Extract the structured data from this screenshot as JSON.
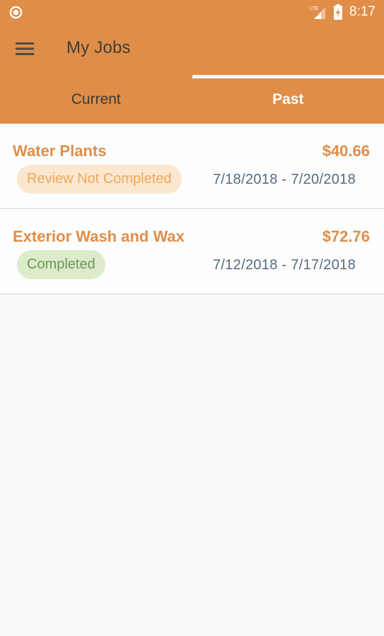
{
  "status_bar": {
    "left_icon": "circle-notification-icon",
    "network_label": "LTE",
    "time": "8:17"
  },
  "app_bar": {
    "menu_icon": "hamburger-menu-icon",
    "title": "My Jobs"
  },
  "tabs": [
    {
      "label": "Current",
      "selected": false
    },
    {
      "label": "Past",
      "selected": true
    }
  ],
  "jobs": [
    {
      "title": "Water Plants",
      "price": "$40.66",
      "status": "Review Not Completed",
      "dates": "7/18/2018 - 7/20/2018"
    },
    {
      "title": "Exterior Wash and Wax",
      "price": "$72.76",
      "status": "Completed",
      "dates": "7/12/2018 - 7/17/2018"
    }
  ],
  "colors": {
    "primary": "#e08d47",
    "badge_review_bg": "#fbe6cf",
    "badge_review_text": "#f0a85c",
    "badge_completed_bg": "#dceccb",
    "badge_completed_text": "#6e9458",
    "date_text": "#546a7f"
  }
}
